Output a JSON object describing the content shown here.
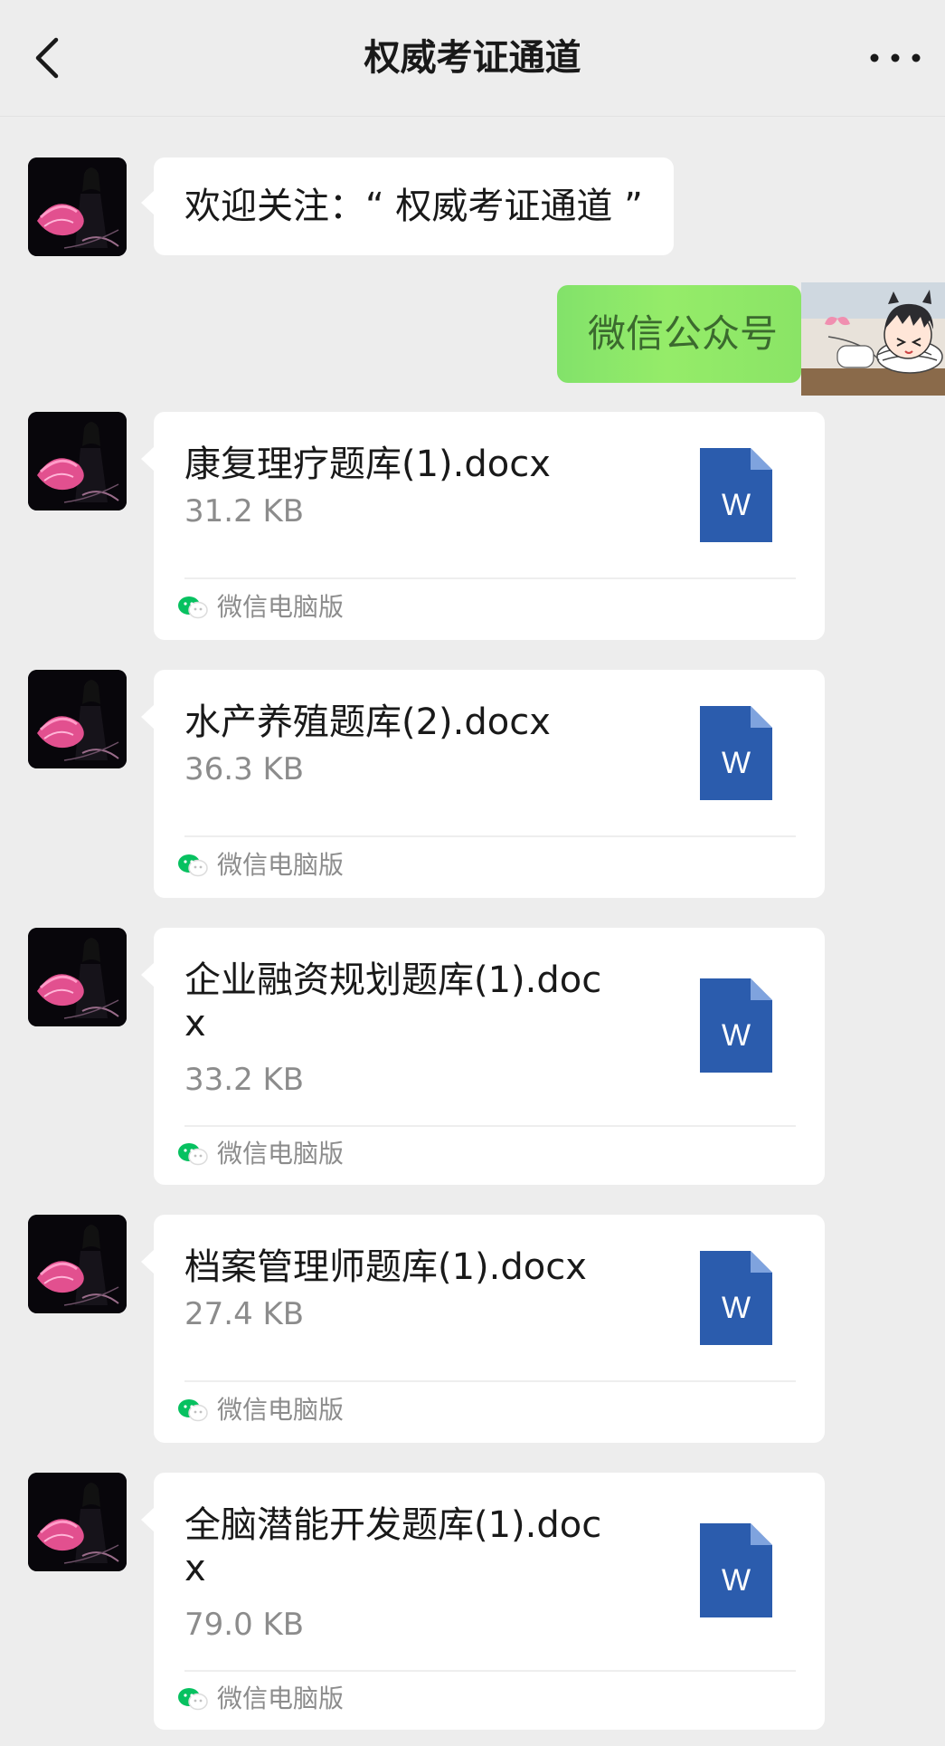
{
  "header": {
    "title": "权威考证通道"
  },
  "messages": {
    "welcome": "欢迎关注：“ 权威考证通道 ”",
    "outgoing": "微信公众号"
  },
  "files": [
    {
      "name": "康复理疗题库(1).docx",
      "size": "31.2 KB",
      "source": "微信电脑版"
    },
    {
      "name": "水产养殖题库(2).docx",
      "size": "36.3 KB",
      "source": "微信电脑版"
    },
    {
      "name": "企业融资规划题库(1).docx",
      "size": "33.2 KB",
      "source": "微信电脑版"
    },
    {
      "name": "档案管理师题库(1).docx",
      "size": "27.4 KB",
      "source": "微信电脑版"
    },
    {
      "name": "全脑潜能开发题库(1).docx",
      "size": "79.0 KB",
      "source": "微信电脑版"
    }
  ],
  "icons": {
    "file": "word-doc-icon",
    "source": "wechat-icon"
  },
  "colors": {
    "background": "#ededed",
    "green_bubble": "#95ec69",
    "word_blue": "#2b5cad",
    "wechat_green": "#07c160"
  }
}
